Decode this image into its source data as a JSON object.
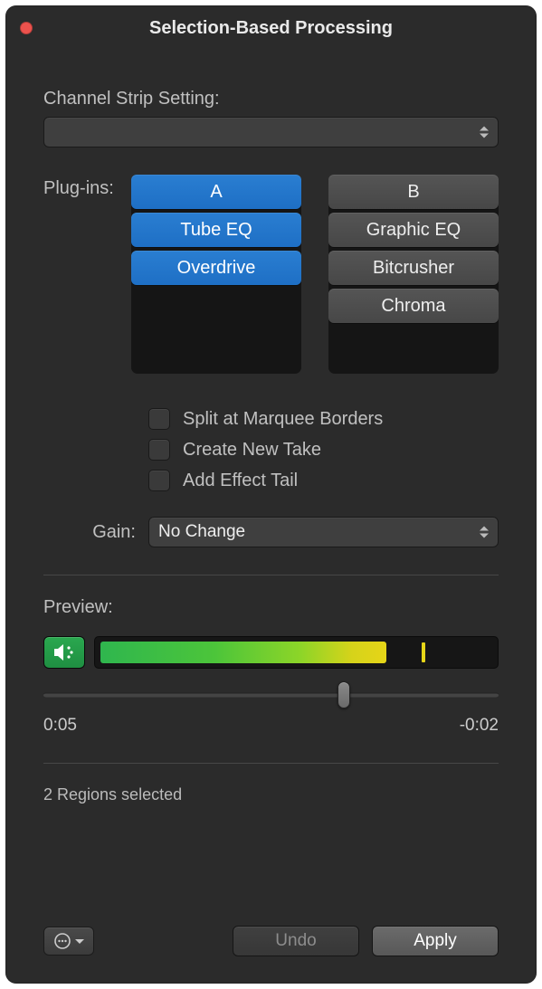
{
  "window": {
    "title": "Selection-Based Processing"
  },
  "channel_strip": {
    "label": "Channel Strip Setting:",
    "value": ""
  },
  "plugins": {
    "label": "Plug-ins:",
    "col_a": {
      "header": "A",
      "items": [
        "Tube EQ",
        "Overdrive"
      ]
    },
    "col_b": {
      "header": "B",
      "items": [
        "Graphic EQ",
        "Bitcrusher",
        "Chroma"
      ]
    }
  },
  "options": {
    "split": "Split at Marquee Borders",
    "new_take": "Create New Take",
    "effect_tail": "Add Effect Tail"
  },
  "gain": {
    "label": "Gain:",
    "value": "No Change"
  },
  "preview": {
    "label": "Preview:",
    "time_elapsed": "0:05",
    "time_remaining": "-0:02"
  },
  "status": "2 Regions selected",
  "buttons": {
    "undo": "Undo",
    "apply": "Apply"
  }
}
